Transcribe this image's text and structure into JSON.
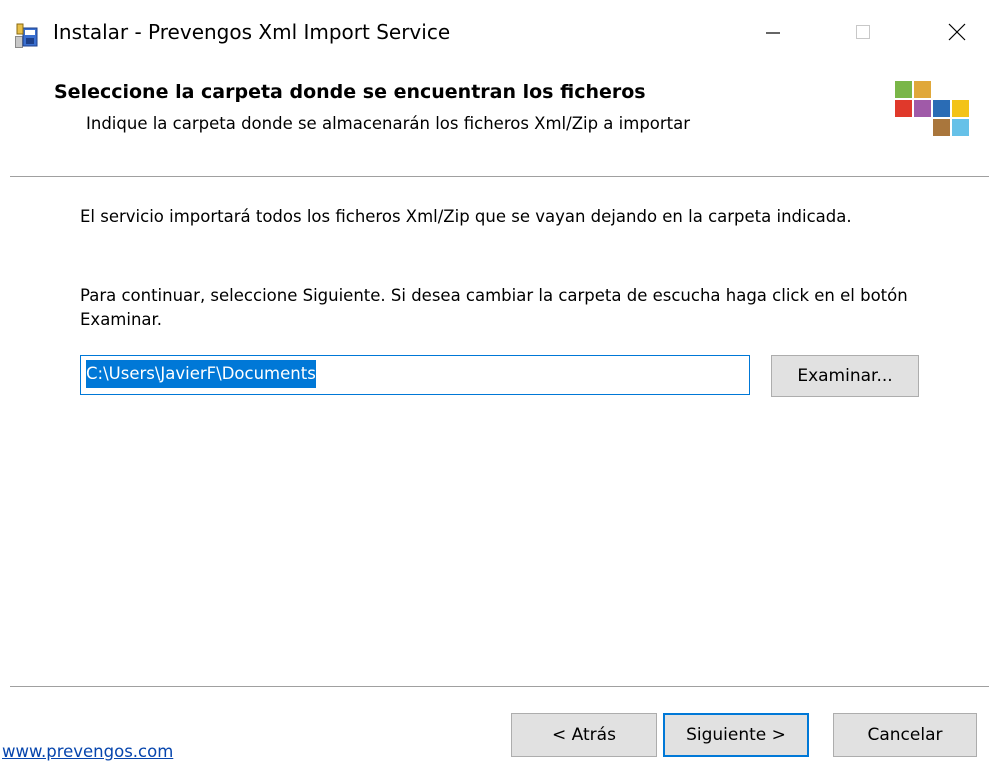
{
  "window": {
    "title": "Instalar - Prevengos Xml Import Service",
    "controls": {
      "minimize": "minimize-icon",
      "maximize": "maximize-icon",
      "close": "close-icon"
    }
  },
  "header": {
    "title": "Seleccione la carpeta donde se encuentran los ficheros",
    "subtitle": "Indique la carpeta donde se almacenarán los ficheros Xml/Zip a importar"
  },
  "content": {
    "paragraph1": "El servicio importará todos los ficheros Xml/Zip que se vayan dejando en la carpeta indicada.",
    "paragraph2": "Para continuar, seleccione Siguiente. Si desea cambiar la carpeta de escucha haga click en el botón Examinar.",
    "path_value": "C:\\Users\\JavierF\\Documents",
    "browse_label": "Examinar..."
  },
  "footer": {
    "link": "www.prevengos.com",
    "back_label": "< Atrás",
    "next_label": "Siguiente >",
    "cancel_label": "Cancelar"
  },
  "colors": {
    "accent": "#0078d7",
    "button_face": "#e1e1e1",
    "link": "#0645ad",
    "logo": [
      "#7ab648",
      "#e0a83a",
      "#e0392b",
      "#a05aa8",
      "#2a6cb5",
      "#f3c318",
      "#a9763c",
      "#66c1e8"
    ]
  }
}
